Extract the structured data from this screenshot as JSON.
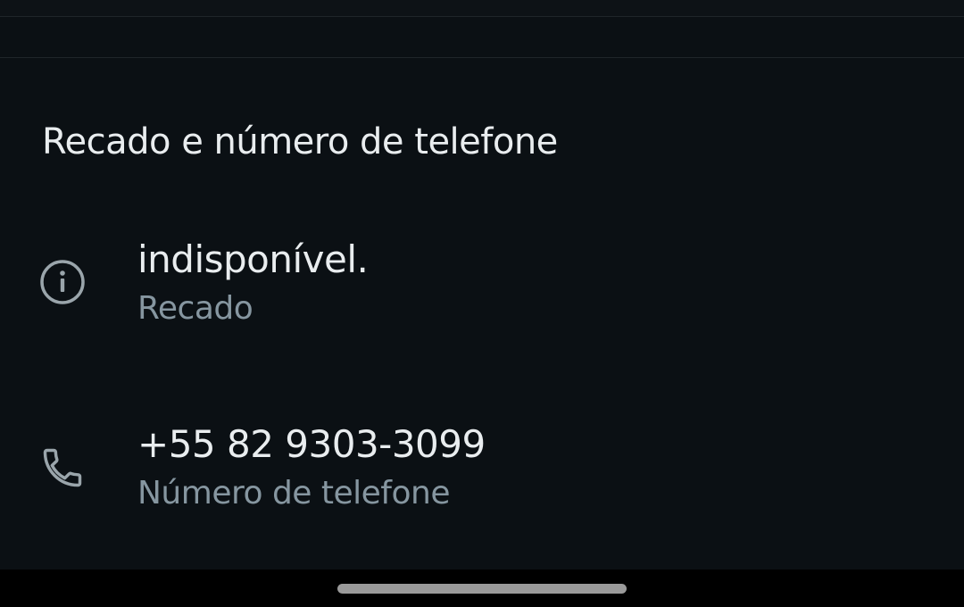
{
  "section": {
    "title": "Recado e número de telefone"
  },
  "about": {
    "icon": "info-icon",
    "value": "indisponível.",
    "label": "Recado"
  },
  "phone": {
    "icon": "phone-icon",
    "value": "+55 82 9303-3099",
    "label": "Número de telefone"
  },
  "colors": {
    "background": "#0b1014",
    "primary_text": "#e9edef",
    "secondary_text": "#8696a0",
    "icon": "#9aa5ab",
    "nav_bar": "#000000"
  }
}
